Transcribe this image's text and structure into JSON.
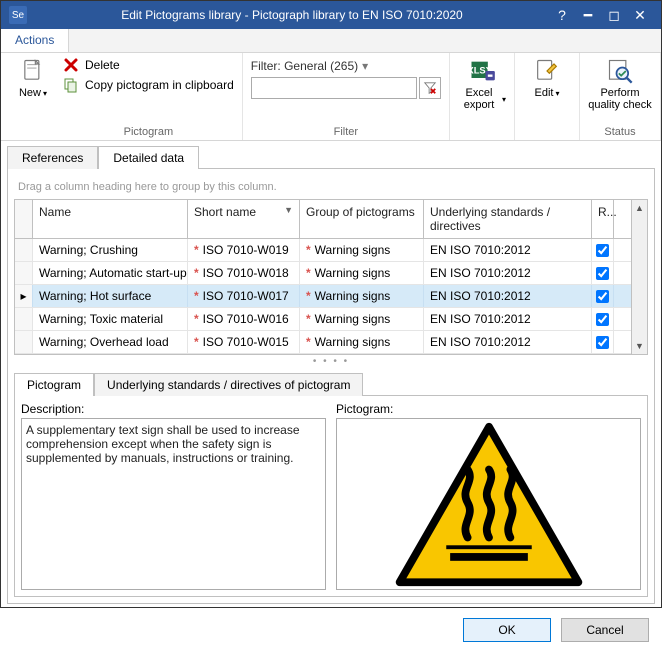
{
  "window": {
    "title": "Edit Pictograms library - Pictograph library to EN ISO 7010:2020",
    "logo_text": "Se"
  },
  "ribbon": {
    "tab": "Actions",
    "new": "New",
    "delete": "Delete",
    "copy": "Copy pictogram in clipboard",
    "group_pictogram": "Pictogram",
    "filter_label": "Filter: General (265)",
    "group_filter": "Filter",
    "excel": "Excel export",
    "edit": "Edit",
    "quality": "Perform quality check",
    "group_status": "Status"
  },
  "tabs": {
    "references": "References",
    "detailed": "Detailed data"
  },
  "grid": {
    "group_hint": "Drag a column heading here to group by this column.",
    "cols": {
      "name": "Name",
      "short": "Short name",
      "group": "Group of pictograms",
      "std": "Underlying standards / directives",
      "rel": "R..."
    },
    "rows": [
      {
        "name": "Warning; Crushing",
        "short": "ISO 7010-W019",
        "group": "Warning signs",
        "std": "EN ISO 7010:2012",
        "rel": true,
        "sel": false
      },
      {
        "name": "Warning; Automatic start-up",
        "short": "ISO 7010-W018",
        "group": "Warning signs",
        "std": "EN ISO 7010:2012",
        "rel": true,
        "sel": false
      },
      {
        "name": "Warning; Hot surface",
        "short": "ISO 7010-W017",
        "group": "Warning signs",
        "std": "EN ISO 7010:2012",
        "rel": true,
        "sel": true
      },
      {
        "name": "Warning; Toxic material",
        "short": "ISO 7010-W016",
        "group": "Warning signs",
        "std": "EN ISO 7010:2012",
        "rel": true,
        "sel": false
      },
      {
        "name": "Warning; Overhead load",
        "short": "ISO 7010-W015",
        "group": "Warning signs",
        "std": "EN ISO 7010:2012",
        "rel": true,
        "sel": false
      }
    ]
  },
  "detail_tabs": {
    "pictogram": "Pictogram",
    "underlying": "Underlying standards / directives of pictogram"
  },
  "detail": {
    "desc_label": "Description:",
    "desc_text": "A supplementary text sign shall be used to increase comprehension except when the safety sign is supplemented by manuals, instructions or training.",
    "pict_label": "Pictogram:"
  },
  "footer": {
    "ok": "OK",
    "cancel": "Cancel"
  }
}
